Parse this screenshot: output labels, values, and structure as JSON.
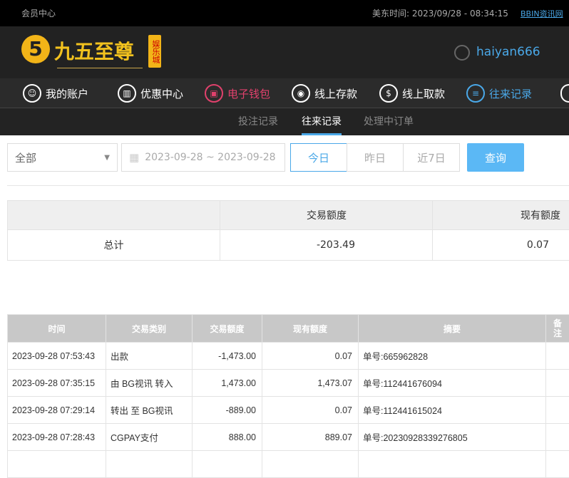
{
  "topbar": {
    "title": "会员中心",
    "time": "美东时间: 2023/09/28 - 08:34:15",
    "link": "BBIN资讯网"
  },
  "header": {
    "logo_text": "九五至尊",
    "logo_badge": "娱乐城",
    "username": "haiyan666"
  },
  "nav": [
    {
      "label": "我的账户",
      "icon": "user-icon"
    },
    {
      "label": "优惠中心",
      "icon": "gift-icon"
    },
    {
      "label": "电子钱包",
      "icon": "wallet-icon"
    },
    {
      "label": "线上存款",
      "icon": "deposit-icon"
    },
    {
      "label": "线上取款",
      "icon": "withdraw-icon"
    },
    {
      "label": "往来记录",
      "icon": "records-icon"
    }
  ],
  "colors": {
    "wallet": "#e0416c",
    "active": "#4aa8e8",
    "query": "#5bb8f5"
  },
  "subnav": [
    "投注记录",
    "往来记录",
    "处理中订单"
  ],
  "filter": {
    "type": "全部",
    "date_range": "2023-09-28 ~ 2023-09-28",
    "today": "今日",
    "yesterday": "昨日",
    "week": "近7日",
    "query": "查询"
  },
  "summary": {
    "headers": [
      "",
      "交易额度",
      "现有额度"
    ],
    "row": [
      "总计",
      "-203.49",
      "0.07"
    ]
  },
  "table": {
    "headers": [
      "时间",
      "交易类别",
      "交易额度",
      "现有额度",
      "摘要",
      "备注"
    ],
    "rows": [
      [
        "2023-09-28 07:53:43",
        "出款",
        "-1,473.00",
        "0.07",
        "单号:665962828",
        ""
      ],
      [
        "2023-09-28 07:35:15",
        "由 BG视讯 转入",
        "1,473.00",
        "1,473.07",
        "单号:112441676094",
        ""
      ],
      [
        "2023-09-28 07:29:14",
        "转出 至 BG视讯",
        "-889.00",
        "0.07",
        "单号:112441615024",
        ""
      ],
      [
        "2023-09-28 07:28:43",
        "CGPAY支付",
        "888.00",
        "889.07",
        "单号:20230928339276805",
        ""
      ]
    ]
  }
}
